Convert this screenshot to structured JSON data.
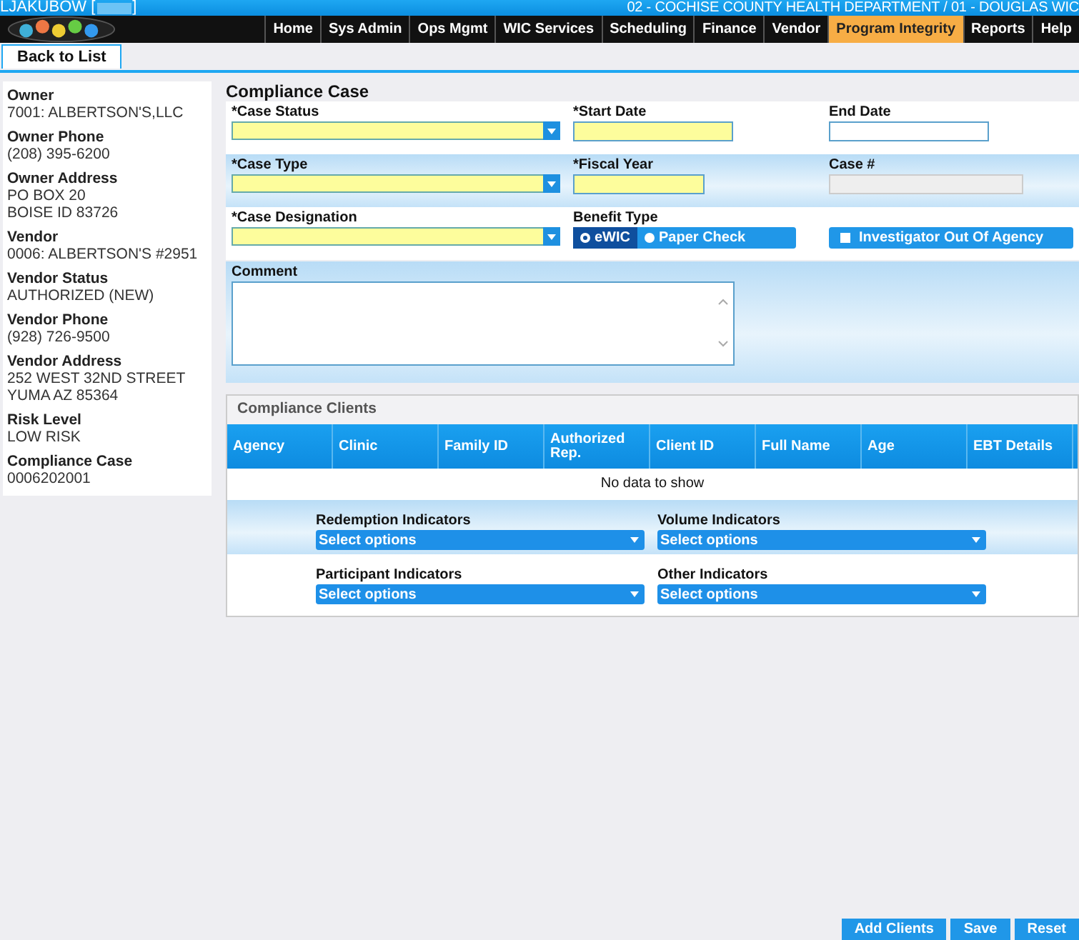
{
  "header": {
    "user": "LJAKUBOW [",
    "user_close": "]",
    "location": "02 - COCHISE COUNTY HEALTH DEPARTMENT / 01 - DOUGLAS WIC"
  },
  "nav": [
    {
      "label": "Home",
      "selected": false
    },
    {
      "label": "Sys Admin",
      "selected": false
    },
    {
      "label": "Ops Mgmt",
      "selected": false
    },
    {
      "label": "WIC Services",
      "selected": false
    },
    {
      "label": "Scheduling",
      "selected": false
    },
    {
      "label": "Finance",
      "selected": false
    },
    {
      "label": "Vendor",
      "selected": false
    },
    {
      "label": "Program Integrity",
      "selected": true
    },
    {
      "label": "Reports",
      "selected": false
    },
    {
      "label": "Help",
      "selected": false
    }
  ],
  "back_button": "Back to List",
  "sidebar": [
    {
      "label": "Owner",
      "lines": [
        "7001: ALBERTSON'S,LLC"
      ]
    },
    {
      "label": "Owner Phone",
      "lines": [
        "(208) 395-6200"
      ]
    },
    {
      "label": "Owner Address",
      "lines": [
        "PO BOX 20",
        "BOISE ID 83726"
      ]
    },
    {
      "label": "Vendor",
      "lines": [
        "0006: ALBERTSON'S #2951"
      ]
    },
    {
      "label": "Vendor Status",
      "lines": [
        "AUTHORIZED (NEW)"
      ]
    },
    {
      "label": "Vendor Phone",
      "lines": [
        "(928) 726-9500"
      ]
    },
    {
      "label": "Vendor Address",
      "lines": [
        "252 WEST 32ND STREET",
        "YUMA AZ 85364"
      ]
    },
    {
      "label": "Risk Level",
      "lines": [
        "LOW RISK"
      ]
    },
    {
      "label": "Compliance Case",
      "lines": [
        "0006202001"
      ]
    }
  ],
  "form": {
    "title": "Compliance Case",
    "rows": [
      {
        "fields": [
          {
            "kind": "select",
            "label": "*Case Status",
            "required": true
          },
          {
            "kind": "text",
            "label": "*Start Date",
            "required": true
          },
          {
            "kind": "text",
            "label": "End Date",
            "required": false
          }
        ]
      },
      {
        "fields": [
          {
            "kind": "select",
            "label": "*Case Type",
            "required": true
          },
          {
            "kind": "text",
            "label": "*Fiscal Year",
            "required": true
          },
          {
            "kind": "text",
            "label": "Case #",
            "required": false,
            "disabled": true
          }
        ]
      },
      {
        "fields": [
          {
            "kind": "select",
            "label": "*Case Designation",
            "required": true
          },
          {
            "kind": "radio",
            "label": "Benefit Type",
            "options": [
              {
                "label": "eWIC",
                "selected": true
              },
              {
                "label": "Paper Check",
                "selected": false
              }
            ]
          },
          {
            "kind": "checkbox",
            "label": "Investigator Out Of Agency",
            "checked": false
          }
        ]
      }
    ],
    "comment_label": "Comment"
  },
  "clients": {
    "title": "Compliance Clients",
    "columns": [
      "Agency",
      "Clinic",
      "Family ID",
      "Authorized Rep.",
      "Client ID",
      "Full Name",
      "Age",
      "EBT Details"
    ],
    "empty": "No data to show",
    "indicators": [
      {
        "label": "Redemption Indicators",
        "placeholder": "Select options"
      },
      {
        "label": "Volume Indicators",
        "placeholder": "Select options"
      },
      {
        "label": "Participant Indicators",
        "placeholder": "Select options"
      },
      {
        "label": "Other Indicators",
        "placeholder": "Select options"
      }
    ]
  },
  "buttons": [
    "Add Clients",
    "Save",
    "Reset"
  ]
}
